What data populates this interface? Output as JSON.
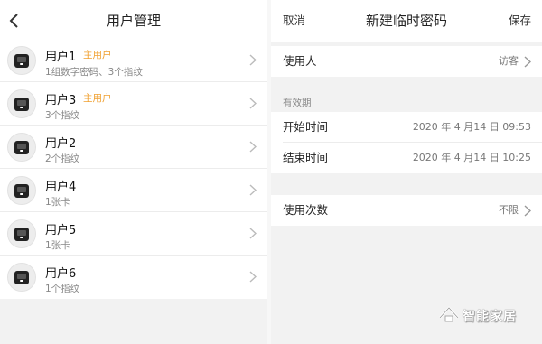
{
  "left": {
    "title": "用户管理",
    "back_icon": "chevron-left-icon",
    "users": [
      {
        "name": "用户1",
        "badge": "主用户",
        "desc": "1组数字密码、3个指纹"
      },
      {
        "name": "用户3",
        "badge": "主用户",
        "desc": "3个指纹"
      },
      {
        "name": "用户2",
        "badge": "",
        "desc": "2个指纹"
      },
      {
        "name": "用户4",
        "badge": "",
        "desc": "1张卡"
      },
      {
        "name": "用户5",
        "badge": "",
        "desc": "1张卡"
      },
      {
        "name": "用户6",
        "badge": "",
        "desc": "1个指纹"
      }
    ]
  },
  "right": {
    "cancel_label": "取消",
    "title": "新建临时密码",
    "save_label": "保存",
    "user_row": {
      "label": "使用人",
      "value": "访客"
    },
    "validity_header": "有效期",
    "start_row": {
      "label": "开始时间",
      "value": "2020 年 4 月14 日 09:53"
    },
    "end_row": {
      "label": "结束时间",
      "value": "2020 年 4 月14 日 10:25"
    },
    "count_row": {
      "label": "使用次数",
      "value": "不限"
    }
  },
  "watermark": {
    "text": "智能家居"
  },
  "colors": {
    "badge": "#f0a030",
    "background": "#f2f2f2",
    "surface": "#ffffff"
  }
}
